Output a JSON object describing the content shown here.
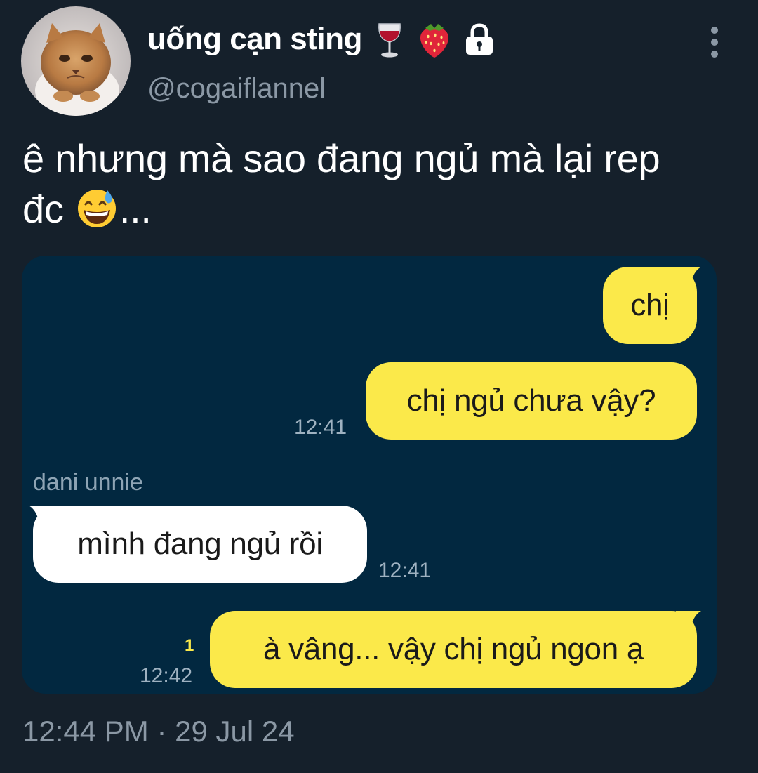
{
  "tweet": {
    "display_name": "uống cạn sting",
    "handle": "@cogaiflannel",
    "text_line1": "ê nhưng mà sao đang ngủ mà lại rep",
    "text_line2_start": "đc",
    "text_line2_end": "...",
    "timestamp": "12:44 PM",
    "date_separator": "·",
    "date": "29 Jul 24",
    "badge_icons": [
      "wine-glass-icon",
      "strawberry-icon",
      "lock-icon"
    ],
    "inline_emoji": "grinning-sweat-emoji"
  },
  "chat": {
    "messages": [
      {
        "direction": "out",
        "text": "chị",
        "time": "",
        "read": ""
      },
      {
        "direction": "out",
        "text": "chị ngủ chưa vậy?",
        "time": "12:41",
        "read": ""
      },
      {
        "direction": "in",
        "sender": "dani unnie",
        "text": "mình đang ngủ rồi",
        "time": "12:41",
        "read": ""
      },
      {
        "direction": "out",
        "text": "à vâng... vậy chị ngủ ngon ạ",
        "time": "12:42",
        "read": "1"
      }
    ],
    "colors": {
      "background": "#022840",
      "outgoing_bubble": "#fbe94a",
      "incoming_bubble": "#ffffff"
    }
  },
  "colors": {
    "page_background": "#15202b",
    "secondary_text": "#8b98a5"
  }
}
